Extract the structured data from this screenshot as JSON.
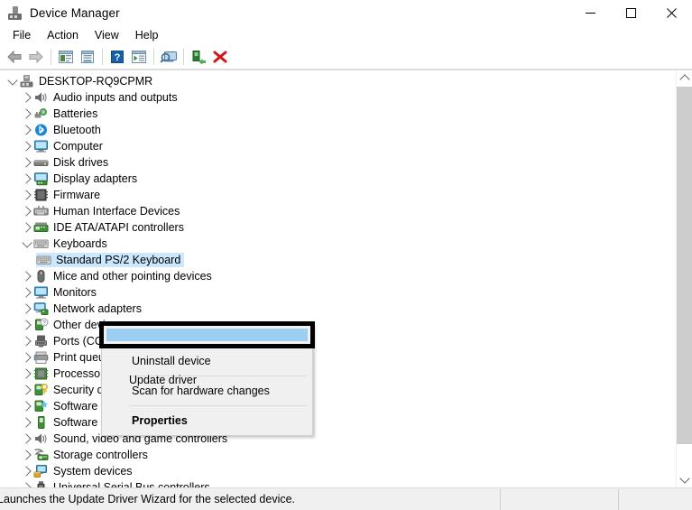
{
  "window": {
    "title": "Device Manager",
    "icon": "device-manager-icon",
    "caption": {
      "minimize": "minimize-icon",
      "maximize": "maximize-icon",
      "close": "close-icon"
    }
  },
  "menubar": {
    "items": [
      {
        "label": "File"
      },
      {
        "label": "Action"
      },
      {
        "label": "View"
      },
      {
        "label": "Help"
      }
    ]
  },
  "toolbar": {
    "buttons": [
      {
        "name": "back-icon"
      },
      {
        "name": "forward-icon"
      },
      {
        "name": "separator"
      },
      {
        "name": "properties-icon"
      },
      {
        "name": "show-hidden-devices-icon"
      },
      {
        "name": "separator"
      },
      {
        "name": "help-icon"
      },
      {
        "name": "update-driver-icon"
      },
      {
        "name": "separator"
      },
      {
        "name": "scan-hardware-changes-icon"
      },
      {
        "name": "separator"
      },
      {
        "name": "enable-device-icon"
      },
      {
        "name": "uninstall-device-icon"
      }
    ]
  },
  "tree": {
    "root": {
      "label": "DESKTOP-RQ9CPMR",
      "icon": "computer-root-icon",
      "state": "expanded"
    },
    "nodes": [
      {
        "label": "Audio inputs and outputs",
        "icon": "speaker-icon",
        "state": "collapsed"
      },
      {
        "label": "Batteries",
        "icon": "battery-icon",
        "state": "collapsed"
      },
      {
        "label": "Bluetooth",
        "icon": "bluetooth-icon",
        "state": "collapsed"
      },
      {
        "label": "Computer",
        "icon": "monitor-icon",
        "state": "collapsed"
      },
      {
        "label": "Disk drives",
        "icon": "disk-drive-icon",
        "state": "collapsed"
      },
      {
        "label": "Display adapters",
        "icon": "display-adapter-icon",
        "state": "collapsed"
      },
      {
        "label": "Firmware",
        "icon": "firmware-chip-icon",
        "state": "collapsed"
      },
      {
        "label": "Human Interface Devices",
        "icon": "hid-icon",
        "state": "collapsed"
      },
      {
        "label": "IDE ATA/ATAPI controllers",
        "icon": "ide-controller-icon",
        "state": "collapsed"
      },
      {
        "label": "Keyboards",
        "icon": "keyboard-icon",
        "state": "expanded"
      },
      {
        "label": "Standard PS/2 Keyboard",
        "icon": "keyboard-icon",
        "state": "leaf",
        "selected": true,
        "indent": 2
      },
      {
        "label": "Mice and other pointing devices",
        "icon": "mouse-icon",
        "state": "collapsed"
      },
      {
        "label": "Monitors",
        "icon": "monitor-icon",
        "state": "collapsed"
      },
      {
        "label": "Network adapters",
        "icon": "network-adapter-icon",
        "state": "collapsed"
      },
      {
        "label": "Other devices",
        "icon": "unknown-device-icon",
        "state": "collapsed"
      },
      {
        "label": "Ports (COM & LPT)",
        "icon": "port-icon",
        "state": "collapsed"
      },
      {
        "label": "Print queues",
        "icon": "printer-icon",
        "state": "collapsed"
      },
      {
        "label": "Processors",
        "icon": "processor-icon",
        "state": "collapsed"
      },
      {
        "label": "Security devices",
        "icon": "security-device-icon",
        "state": "collapsed"
      },
      {
        "label": "Software components",
        "icon": "software-component-icon",
        "state": "collapsed"
      },
      {
        "label": "Software devices",
        "icon": "software-device-icon",
        "state": "collapsed"
      },
      {
        "label": "Sound, video and game controllers",
        "icon": "speaker-icon",
        "state": "collapsed"
      },
      {
        "label": "Storage controllers",
        "icon": "storage-controller-icon",
        "state": "collapsed"
      },
      {
        "label": "System devices",
        "icon": "system-device-icon",
        "state": "collapsed"
      },
      {
        "label": "Universal Serial Bus controllers",
        "icon": "usb-icon",
        "state": "collapsed"
      }
    ]
  },
  "context_menu": {
    "items": [
      {
        "label": "Update driver",
        "highlighted": true,
        "annotated": true
      },
      {
        "label": "Uninstall device"
      },
      {
        "separator_after": true,
        "label": "Scan for hardware changes"
      },
      {
        "label": "Properties",
        "bold": true
      }
    ]
  },
  "statusbar": {
    "message": "Launches the Update Driver Wizard for the selected device.",
    "pane2": "",
    "pane3": ""
  },
  "colors": {
    "selection_blue": "#cce8ff",
    "menu_highlight": "#9ccef2",
    "annotation": "#000000",
    "window_bg": "#f0f0f0"
  },
  "scrollbar": {
    "up_arrow": "chevron-up-icon",
    "down_arrow": "chevron-down-icon"
  }
}
